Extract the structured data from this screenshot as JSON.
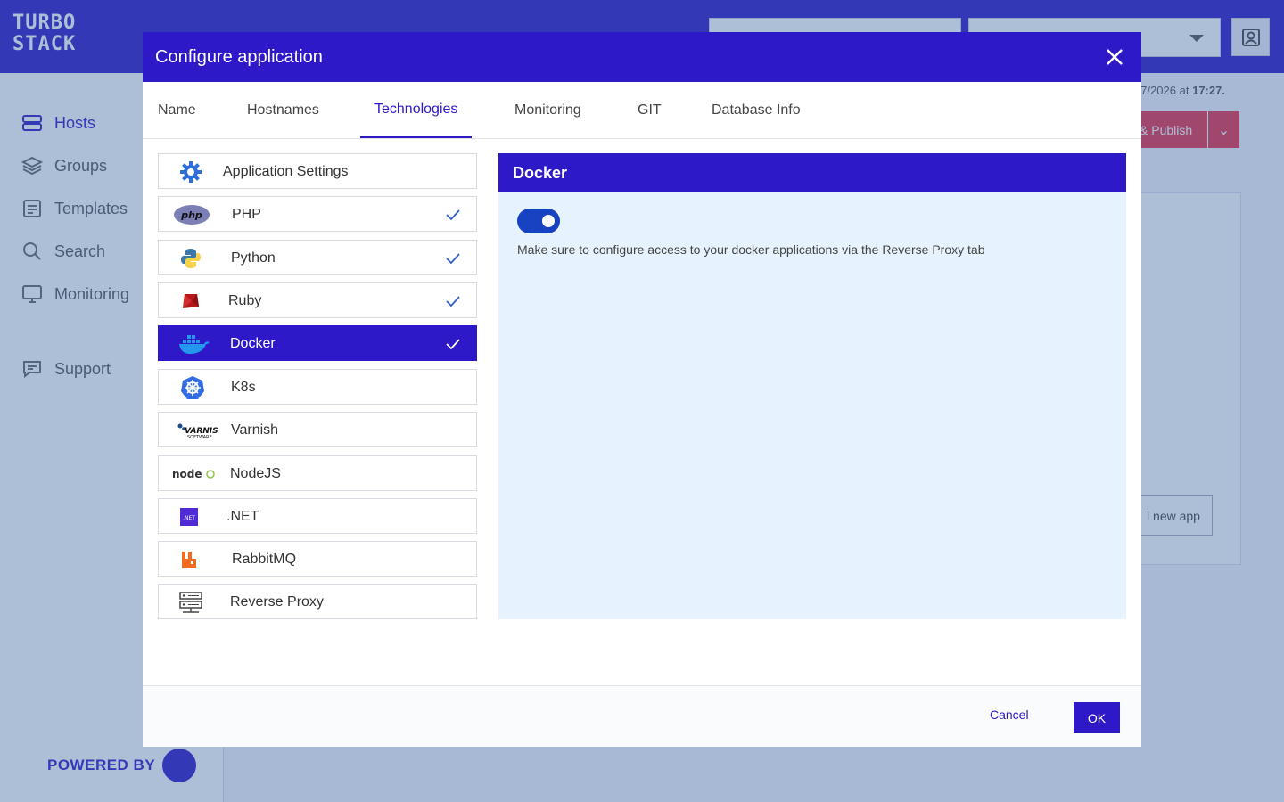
{
  "app": {
    "logo_text_line1": "TURBO",
    "logo_text_line2": "STACK",
    "powered_by": "POWERED BY"
  },
  "sidebar": {
    "items": [
      {
        "label": "Hosts",
        "icon": "hosts-icon",
        "active": true
      },
      {
        "label": "Groups",
        "icon": "layers-icon"
      },
      {
        "label": "Templates",
        "icon": "template-icon"
      },
      {
        "label": "Search",
        "icon": "search-icon"
      },
      {
        "label": "Monitoring",
        "icon": "monitor-icon"
      },
      {
        "label": "Support",
        "icon": "support-chat-icon"
      }
    ]
  },
  "background": {
    "timestamp_prefix": "07/2026",
    "timestamp_at": "at",
    "timestamp_time": "17:27.",
    "publish_label": "& Publish",
    "new_app_label": "l new app"
  },
  "modal": {
    "title": "Configure application",
    "tabs": [
      {
        "label": "Name"
      },
      {
        "label": "Hostnames"
      },
      {
        "label": "Technologies",
        "active": true
      },
      {
        "label": "Monitoring"
      },
      {
        "label": "GIT"
      },
      {
        "label": "Database Info"
      }
    ],
    "technologies": [
      {
        "label": "Application Settings",
        "icon": "gear-icon",
        "checked": false
      },
      {
        "label": "PHP",
        "icon": "php-logo-icon",
        "checked": true
      },
      {
        "label": "Python",
        "icon": "python-logo-icon",
        "checked": true
      },
      {
        "label": "Ruby",
        "icon": "ruby-logo-icon",
        "checked": true
      },
      {
        "label": "Docker",
        "icon": "docker-logo-icon",
        "checked": true,
        "active": true
      },
      {
        "label": "K8s",
        "icon": "kubernetes-logo-icon",
        "checked": false
      },
      {
        "label": "Varnish",
        "icon": "varnish-logo-icon",
        "checked": false
      },
      {
        "label": "NodeJS",
        "icon": "nodejs-logo-icon",
        "checked": false
      },
      {
        "label": ".NET",
        "icon": "dotnet-logo-icon",
        "checked": false
      },
      {
        "label": "RabbitMQ",
        "icon": "rabbitmq-logo-icon",
        "checked": false
      },
      {
        "label": "Reverse Proxy",
        "icon": "server-icon",
        "checked": false
      }
    ],
    "detail": {
      "title": "Docker",
      "toggle_on": true,
      "description": "Make sure to configure access to your docker applications via the Reverse Proxy tab"
    },
    "footer": {
      "cancel_label": "Cancel",
      "ok_label": "OK"
    }
  },
  "colors": {
    "brand": "#2d19c8",
    "detail_bg": "#e6f3ff",
    "toggle": "#1742c2"
  }
}
